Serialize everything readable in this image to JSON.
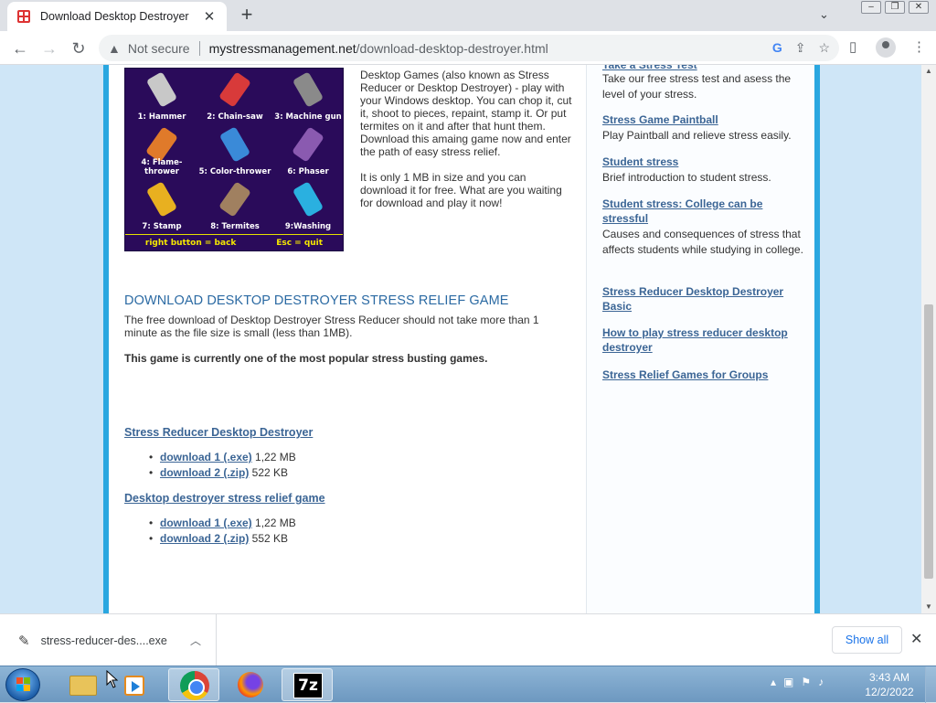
{
  "browser": {
    "tab_title": "Download Desktop Destroyer",
    "tab_close": "✕",
    "new_tab": "+",
    "not_secure": "Not secure",
    "url_domain": "mystressmanagement.net",
    "url_path": "/download-desktop-destroyer.html"
  },
  "game_image": {
    "tools": [
      {
        "label": "1: Hammer",
        "color": "#c8c8c8"
      },
      {
        "label": "2: Chain-saw",
        "color": "#d83a3a"
      },
      {
        "label": "3: Machine gun",
        "color": "#8a8a8a"
      },
      {
        "label": "4: Flame-thrower",
        "color": "#e07a2a"
      },
      {
        "label": "5: Color-thrower",
        "color": "#3a8ad8"
      },
      {
        "label": "6: Phaser",
        "color": "#8a5ab0"
      },
      {
        "label": "7: Stamp",
        "color": "#e8b020"
      },
      {
        "label": "8: Termites",
        "color": "#a08060"
      },
      {
        "label": "9:Washing",
        "color": "#2ab0e0"
      }
    ],
    "footer_left": "right button = back",
    "footer_right": "Esc = quit"
  },
  "intro": {
    "p1": "Desktop Games (also known as Stress Reducer or Desktop Destroyer) - play with your Windows desktop. You can chop it, cut it, shoot to pieces, repaint, stamp it. Or put termites on it and after that hunt them. Download this amaing game now and enter the path of easy stress relief.",
    "p2": "It is only 1 MB in size and you can download it for free. What are you waiting for download and play it now!"
  },
  "main": {
    "heading": "DOWNLOAD DESKTOP DESTROYER STRESS RELIEF GAME",
    "body": "The free download of Desktop Destroyer Stress Reducer should not take more than 1 minute as the file size is small (less than 1MB).",
    "bold": "This game is currently one of the most popular stress busting games."
  },
  "downloads": [
    {
      "title": "Stress Reducer Desktop Destroyer",
      "items": [
        {
          "link": "download 1 (.exe)",
          "size": "1,22 MB"
        },
        {
          "link": "download 2 (.zip)",
          "size": "522 KB"
        }
      ]
    },
    {
      "title": "Desktop destroyer stress relief game",
      "items": [
        {
          "link": "download 1 (.exe)",
          "size": "1,22 MB"
        },
        {
          "link": "download 2 (.zip)",
          "size": "552 KB"
        }
      ]
    }
  ],
  "sidebar": {
    "top_link": "Take a Stress Test",
    "top_desc": "Take our free stress test and asess the level of your stress.",
    "links": [
      {
        "title": "Stress Game Paintball",
        "desc": "Play Paintball and relieve stress easily."
      },
      {
        "title": "Student stress",
        "desc": "Brief introduction to student stress."
      },
      {
        "title": "Student stress: College can be stressful",
        "desc": "Causes and consequences of stress that affects students while studying in college."
      },
      {
        "title": "Stress Reducer Desktop Destroyer Basic",
        "desc": ""
      },
      {
        "title": "How to play stress reducer desktop destroyer",
        "desc": ""
      },
      {
        "title": "Stress Relief Games for Groups",
        "desc": ""
      }
    ]
  },
  "download_shelf": {
    "file_name": "stress-reducer-des....exe",
    "show_all": "Show all"
  },
  "taskbar": {
    "time": "3:43 AM",
    "date": "12/2/2022"
  }
}
